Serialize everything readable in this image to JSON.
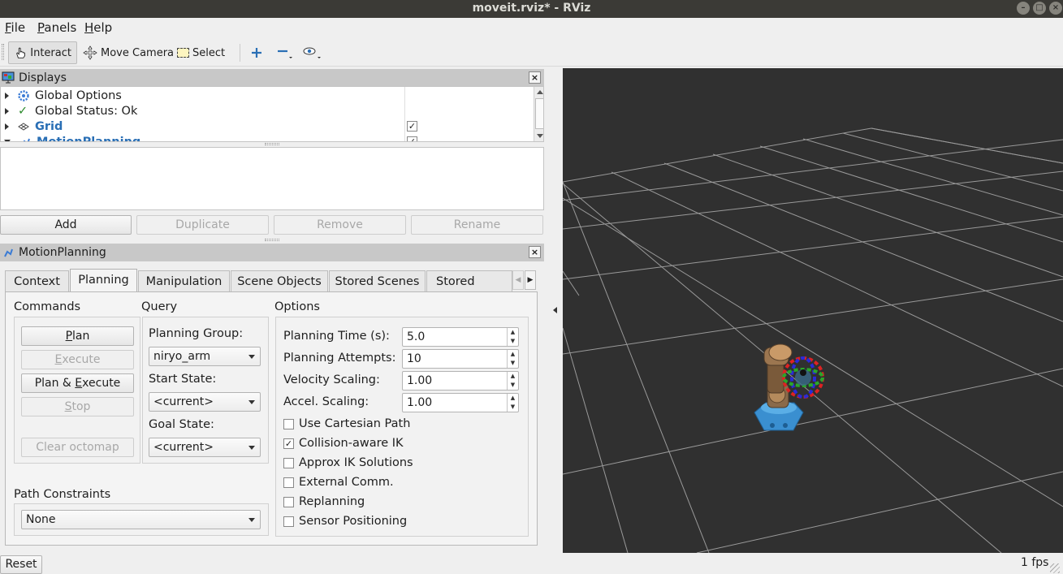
{
  "window": {
    "title": "moveit.rviz* - RViz"
  },
  "menu": [
    {
      "label": "File",
      "mnemonic": "F",
      "rest": "ile"
    },
    {
      "label": "Panels",
      "mnemonic": "P",
      "rest": "anels"
    },
    {
      "label": "Help",
      "mnemonic": "H",
      "rest": "elp"
    }
  ],
  "toolbar": {
    "interact": "Interact",
    "move_camera": "Move Camera",
    "select": "Select"
  },
  "displays": {
    "title": "Displays",
    "items": [
      {
        "label": "Global Options",
        "icon": "gear-icon",
        "checked": null
      },
      {
        "label": "Global Status: Ok",
        "icon": "check-icon",
        "checked": null
      },
      {
        "label": "Grid",
        "icon": "grid-icon",
        "checked": true
      },
      {
        "label": "MotionPlanning",
        "icon": "motionplanning-icon",
        "checked": true
      }
    ],
    "buttons": {
      "add": "Add",
      "duplicate": "Duplicate",
      "remove": "Remove",
      "rename": "Rename"
    }
  },
  "motion_planning": {
    "title": "MotionPlanning",
    "tabs": [
      "Context",
      "Planning",
      "Manipulation",
      "Scene Objects",
      "Stored Scenes",
      "Stored States"
    ],
    "selected_tab": "Planning",
    "commands": {
      "title": "Commands",
      "plan": {
        "pre": "",
        "mn": "P",
        "post": "lan"
      },
      "execute": {
        "pre": "",
        "mn": "E",
        "post": "xecute"
      },
      "plan_execute": {
        "pre": "Plan & ",
        "mn": "E",
        "post": "xecute"
      },
      "stop": {
        "pre": "",
        "mn": "S",
        "post": "top"
      },
      "clear_octomap": "Clear octomap"
    },
    "query": {
      "title": "Query",
      "planning_group_label": "Planning Group:",
      "planning_group": "niryo_arm",
      "start_state_label": "Start State:",
      "start_state": "<current>",
      "goal_state_label": "Goal State:",
      "goal_state": "<current>"
    },
    "options": {
      "title": "Options",
      "planning_time_label": "Planning Time (s):",
      "planning_time": "5.0",
      "planning_attempts_label": "Planning Attempts:",
      "planning_attempts": "10",
      "velocity_scaling_label": "Velocity Scaling:",
      "velocity_scaling": "1.00",
      "accel_scaling_label": "Accel. Scaling:",
      "accel_scaling": "1.00",
      "checkboxes": [
        {
          "label": "Use Cartesian Path",
          "checked": false
        },
        {
          "label": "Collision-aware IK",
          "checked": true
        },
        {
          "label": "Approx IK Solutions",
          "checked": false
        },
        {
          "label": "External Comm.",
          "checked": false
        },
        {
          "label": "Replanning",
          "checked": false
        },
        {
          "label": "Sensor Positioning",
          "checked": false
        }
      ]
    },
    "path_constraints": {
      "title": "Path Constraints",
      "value": "None"
    }
  },
  "status": {
    "reset": "Reset",
    "fps": "1 fps"
  },
  "colors": {
    "viewport_bg": "#303030",
    "grid_line": "#9a9a9a",
    "link_blue": "#2a6fb5",
    "robot_base": "#3a8fd0",
    "robot_body": "#8a6a4a"
  }
}
